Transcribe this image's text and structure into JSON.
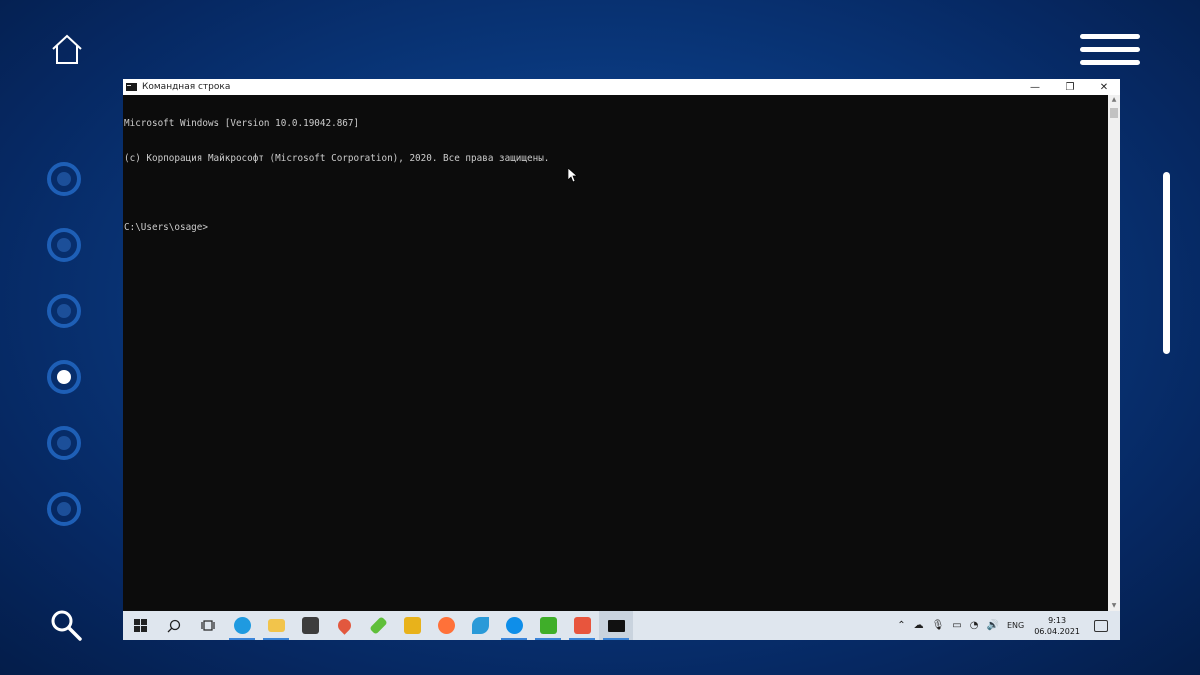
{
  "window": {
    "title": "Командная строка",
    "minimize": "—",
    "maximize": "❐",
    "close": "✕"
  },
  "console": {
    "lines": [
      "Microsoft Windows [Version 10.0.19042.867]",
      "(c) Корпорация Майкрософт (Microsoft Corporation), 2020. Все права защищены.",
      "",
      "C:\\Users\\osage>"
    ]
  },
  "taskbar": {
    "apps": [
      {
        "name": "start",
        "icon": "windows-logo-icon"
      },
      {
        "name": "search",
        "icon": "search-icon"
      },
      {
        "name": "task-view",
        "icon": "task-view-icon"
      },
      {
        "name": "edge",
        "icon": "edge-icon",
        "color": "#1f9ae0"
      },
      {
        "name": "file-explorer",
        "icon": "folder-icon",
        "color": "#f2c44b"
      },
      {
        "name": "store",
        "icon": "store-icon",
        "color": "#3d3d3d"
      },
      {
        "name": "maps",
        "icon": "map-pin-icon",
        "color": "#e2583e"
      },
      {
        "name": "sims",
        "icon": "plumbob-icon",
        "color": "#5fbf3a"
      },
      {
        "name": "among-us",
        "icon": "among-us-icon",
        "color": "#e8b21b"
      },
      {
        "name": "firefox",
        "icon": "firefox-icon",
        "color": "#ff7139"
      },
      {
        "name": "wave",
        "icon": "wave-icon",
        "color": "#2a9ad8"
      },
      {
        "name": "teamviewer",
        "icon": "teamviewer-icon",
        "color": "#0e8ee9"
      },
      {
        "name": "ccleaner-green",
        "icon": "c-green-icon",
        "color": "#3fae29"
      },
      {
        "name": "ccleaner-red",
        "icon": "c-red-icon",
        "color": "#e8553d"
      },
      {
        "name": "cmd",
        "icon": "cmd-icon",
        "color": "#111111"
      }
    ],
    "lang": "ENG",
    "time": "9:13",
    "date": "06.04.2021"
  }
}
